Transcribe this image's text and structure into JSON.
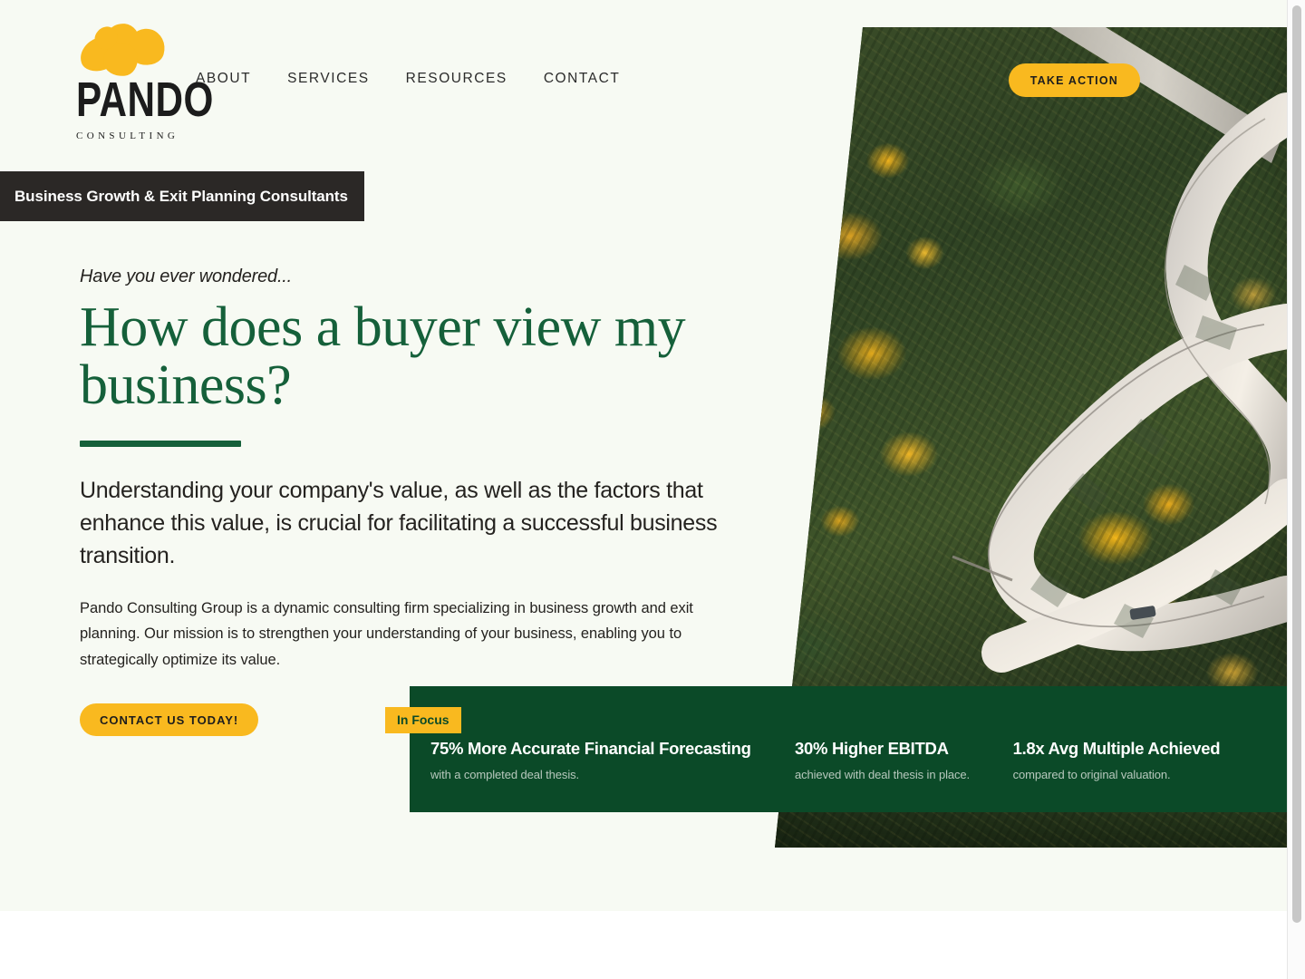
{
  "brand": {
    "name": "PANDO",
    "subtitle": "CONSULTING",
    "logo_icon": "aspen-leaves-icon",
    "yellow": "#f9b91f",
    "green": "#15603a",
    "dark_green": "#0b4a28",
    "dark": "#2b2826",
    "page_bg": "#f7faf3"
  },
  "nav": {
    "items": [
      {
        "label": "ABOUT"
      },
      {
        "label": "SERVICES"
      },
      {
        "label": "RESOURCES"
      },
      {
        "label": "CONTACT"
      }
    ],
    "cta_label": "TAKE ACTION"
  },
  "tagline": {
    "text": "Business Growth & Exit Planning Consultants"
  },
  "hero": {
    "eyebrow": "Have you ever wondered...",
    "headline": "How does a buyer view my business?",
    "subhead": "Understanding your company's value, as well as the factors that enhance this value, is crucial for facilitating a successful business transition.",
    "body": "Pando Consulting Group is a dynamic consulting firm specializing in business growth and exit planning. Our mission is to strengthen your understanding of your business, enabling you to strategically optimize its value.",
    "cta_label": "CONTACT US TODAY!",
    "image_alt": "aerial-view-winding-mountain-road-autumn-forest"
  },
  "stats": {
    "badge": "In Focus",
    "items": [
      {
        "title": "75% More Accurate Financial Forecasting",
        "sub": "with a completed deal thesis."
      },
      {
        "title": "30% Higher EBITDA",
        "sub": "achieved with deal thesis in place."
      },
      {
        "title": "1.8x Avg Multiple Achieved",
        "sub": "compared to original valuation."
      }
    ]
  }
}
